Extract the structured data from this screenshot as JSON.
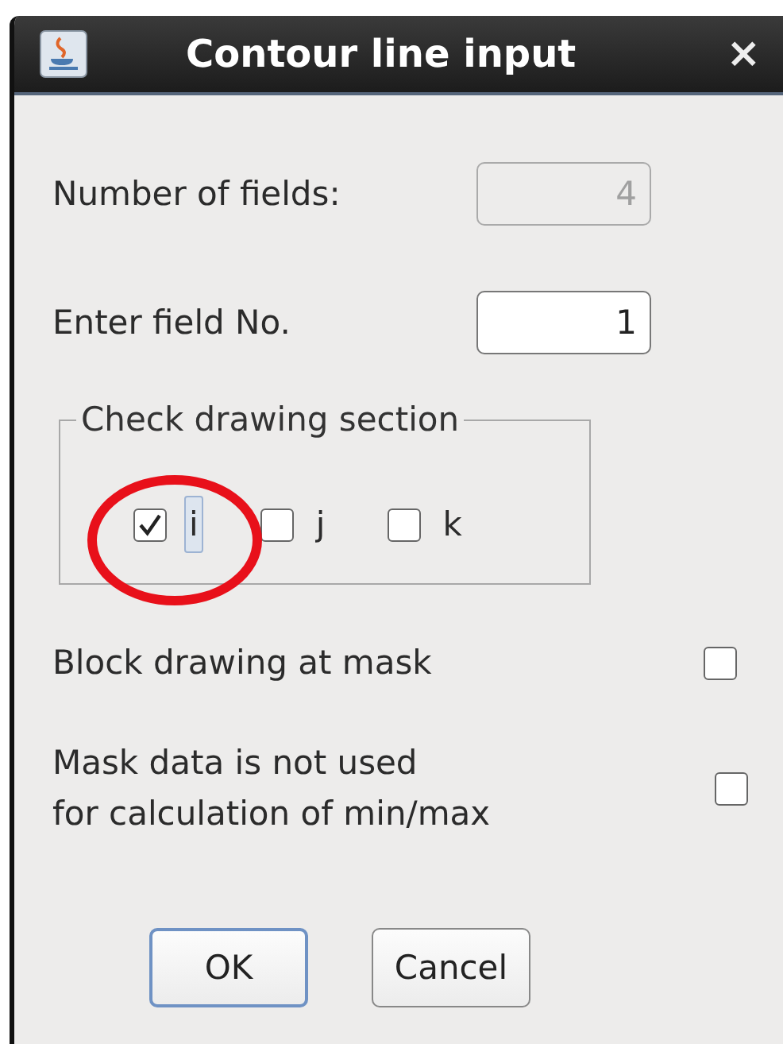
{
  "window": {
    "title": "Contour line input",
    "close": "×"
  },
  "fields": [
    {
      "label": "Number of fields:",
      "value": "4",
      "disabled": true
    },
    {
      "label": "Enter field No.",
      "value": "1",
      "disabled": false
    }
  ],
  "section": {
    "title": "Check drawing section",
    "options": [
      {
        "label": "i",
        "checked": true,
        "focused": true
      },
      {
        "label": "j",
        "checked": false,
        "focused": false
      },
      {
        "label": "k",
        "checked": false,
        "focused": false
      }
    ]
  },
  "options": [
    {
      "lines": [
        "Block drawing at mask"
      ],
      "checked": false
    },
    {
      "lines": [
        "Mask data is not used",
        "for calculation of min/max"
      ],
      "checked": false
    }
  ],
  "buttons": [
    {
      "label": "OK",
      "default": true
    },
    {
      "label": "Cancel",
      "default": false
    }
  ]
}
